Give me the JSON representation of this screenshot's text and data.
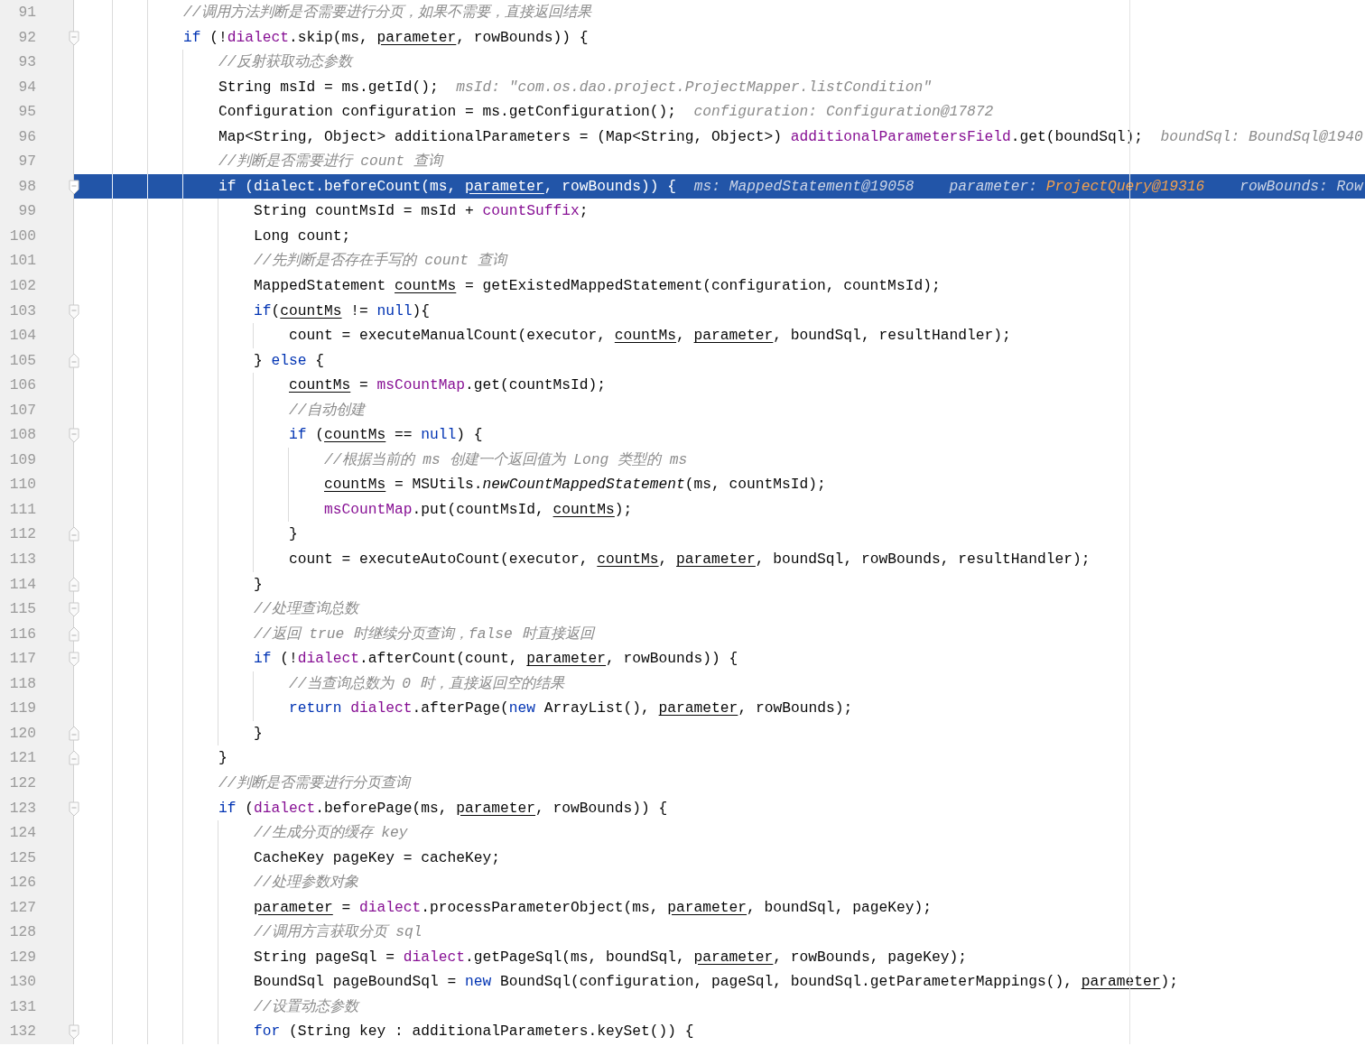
{
  "editor": {
    "lines": [
      {
        "number": "91",
        "selected": false,
        "tokens": [
          {
            "kind": "comment",
            "text": "            //调用方法判断是否需要进行分页，如果不需要，直接返回结果"
          }
        ]
      },
      {
        "number": "92",
        "selected": false,
        "fold": {
          "kind": "open"
        },
        "tokens": [
          {
            "kind": "keyword",
            "text": "            if"
          },
          {
            "kind": "plain",
            "text": " (!"
          },
          {
            "kind": "field",
            "text": "dialect"
          },
          {
            "kind": "plain",
            "text": ".skip(ms, "
          },
          {
            "kind": "var",
            "text": "parameter"
          },
          {
            "kind": "plain",
            "text": ", rowBounds)) {"
          }
        ]
      },
      {
        "number": "93",
        "selected": false,
        "tokens": [
          {
            "kind": "comment",
            "text": "                //反射获取动态参数"
          }
        ]
      },
      {
        "number": "94",
        "selected": false,
        "tokens": [
          {
            "kind": "plain",
            "text": "                String msId = ms.getId();"
          }
        ],
        "hints": [
          {
            "label": "msId:",
            "value": "\"com.os.dao.project.ProjectMapper.listCondition\"",
            "changed": false
          }
        ]
      },
      {
        "number": "95",
        "selected": false,
        "tokens": [
          {
            "kind": "plain",
            "text": "                Configuration configuration = ms.getConfiguration();"
          }
        ],
        "hints": [
          {
            "label": "configuration:",
            "value": "Configuration@17872",
            "changed": false
          }
        ]
      },
      {
        "number": "96",
        "selected": false,
        "tokens": [
          {
            "kind": "plain",
            "text": "                Map<String, Object> additionalParameters = (Map<String, Object>) "
          },
          {
            "kind": "field",
            "text": "additionalParametersField"
          },
          {
            "kind": "plain",
            "text": ".get(boundSql);"
          }
        ],
        "hints": [
          {
            "label": "boundSql:",
            "value": "BoundSql@1940",
            "changed": false
          }
        ]
      },
      {
        "number": "97",
        "selected": false,
        "tokens": [
          {
            "kind": "comment",
            "text": "                //判断是否需要进行 count 查询"
          }
        ]
      },
      {
        "number": "98",
        "selected": true,
        "fold": {
          "kind": "open"
        },
        "tokens": [
          {
            "kind": "keyword",
            "text": "                if"
          },
          {
            "kind": "plain",
            "text": " ("
          },
          {
            "kind": "field",
            "text": "dialect"
          },
          {
            "kind": "plain",
            "text": ".beforeCount(ms, "
          },
          {
            "kind": "var",
            "text": "parameter"
          },
          {
            "kind": "plain",
            "text": ", rowBounds)) {"
          }
        ],
        "hints": [
          {
            "label": "ms:",
            "value": "MappedStatement@19058",
            "changed": false
          },
          {
            "label": "parameter:",
            "value": "ProjectQuery@19316",
            "changed": true
          },
          {
            "label": "rowBounds:",
            "value": "Row",
            "changed": false
          }
        ]
      },
      {
        "number": "99",
        "selected": false,
        "tokens": [
          {
            "kind": "plain",
            "text": "                    String countMsId = msId + "
          },
          {
            "kind": "field",
            "text": "countSuffix"
          },
          {
            "kind": "plain",
            "text": ";"
          }
        ]
      },
      {
        "number": "100",
        "selected": false,
        "tokens": [
          {
            "kind": "plain",
            "text": "                    Long count;"
          }
        ]
      },
      {
        "number": "101",
        "selected": false,
        "tokens": [
          {
            "kind": "comment",
            "text": "                    //先判断是否存在手写的 count 查询"
          }
        ]
      },
      {
        "number": "102",
        "selected": false,
        "tokens": [
          {
            "kind": "plain",
            "text": "                    MappedStatement "
          },
          {
            "kind": "var",
            "text": "countMs"
          },
          {
            "kind": "plain",
            "text": " = getExistedMappedStatement(configuration, countMsId);"
          }
        ]
      },
      {
        "number": "103",
        "selected": false,
        "fold": {
          "kind": "open"
        },
        "tokens": [
          {
            "kind": "keyword",
            "text": "                    if"
          },
          {
            "kind": "plain",
            "text": "("
          },
          {
            "kind": "var",
            "text": "countMs"
          },
          {
            "kind": "plain",
            "text": " != "
          },
          {
            "kind": "keyword",
            "text": "null"
          },
          {
            "kind": "plain",
            "text": "){"
          }
        ]
      },
      {
        "number": "104",
        "selected": false,
        "tokens": [
          {
            "kind": "plain",
            "text": "                        count = executeManualCount(executor, "
          },
          {
            "kind": "var",
            "text": "countMs"
          },
          {
            "kind": "plain",
            "text": ", "
          },
          {
            "kind": "var",
            "text": "parameter"
          },
          {
            "kind": "plain",
            "text": ", boundSql, resultHandler);"
          }
        ]
      },
      {
        "number": "105",
        "selected": false,
        "fold": {
          "kind": "close"
        },
        "tokens": [
          {
            "kind": "plain",
            "text": "                    } "
          },
          {
            "kind": "keyword",
            "text": "else"
          },
          {
            "kind": "plain",
            "text": " {"
          }
        ]
      },
      {
        "number": "106",
        "selected": false,
        "tokens": [
          {
            "kind": "var",
            "text": "                        countMs"
          },
          {
            "kind": "plain",
            "text": " = "
          },
          {
            "kind": "field",
            "text": "msCountMap"
          },
          {
            "kind": "plain",
            "text": ".get(countMsId);"
          }
        ]
      },
      {
        "number": "107",
        "selected": false,
        "tokens": [
          {
            "kind": "comment",
            "text": "                        //自动创建"
          }
        ]
      },
      {
        "number": "108",
        "selected": false,
        "fold": {
          "kind": "open"
        },
        "tokens": [
          {
            "kind": "keyword",
            "text": "                        if"
          },
          {
            "kind": "plain",
            "text": " ("
          },
          {
            "kind": "var",
            "text": "countMs"
          },
          {
            "kind": "plain",
            "text": " == "
          },
          {
            "kind": "keyword",
            "text": "null"
          },
          {
            "kind": "plain",
            "text": ") {"
          }
        ]
      },
      {
        "number": "109",
        "selected": false,
        "tokens": [
          {
            "kind": "comment",
            "text": "                            //根据当前的 ms 创建一个返回值为 Long 类型的 ms"
          }
        ]
      },
      {
        "number": "110",
        "selected": false,
        "tokens": [
          {
            "kind": "var",
            "text": "                            countMs"
          },
          {
            "kind": "plain",
            "text": " = MSUtils."
          },
          {
            "kind": "static",
            "text": "newCountMappedStatement"
          },
          {
            "kind": "plain",
            "text": "(ms, countMsId);"
          }
        ]
      },
      {
        "number": "111",
        "selected": false,
        "tokens": [
          {
            "kind": "field",
            "text": "                            msCountMap"
          },
          {
            "kind": "plain",
            "text": ".put(countMsId, "
          },
          {
            "kind": "var",
            "text": "countMs"
          },
          {
            "kind": "plain",
            "text": ");"
          }
        ]
      },
      {
        "number": "112",
        "selected": false,
        "fold": {
          "kind": "close"
        },
        "tokens": [
          {
            "kind": "plain",
            "text": "                        }"
          }
        ]
      },
      {
        "number": "113",
        "selected": false,
        "tokens": [
          {
            "kind": "plain",
            "text": "                        count = executeAutoCount(executor, "
          },
          {
            "kind": "var",
            "text": "countMs"
          },
          {
            "kind": "plain",
            "text": ", "
          },
          {
            "kind": "var",
            "text": "parameter"
          },
          {
            "kind": "plain",
            "text": ", boundSql, rowBounds, resultHandler);"
          }
        ]
      },
      {
        "number": "114",
        "selected": false,
        "fold": {
          "kind": "close"
        },
        "tokens": [
          {
            "kind": "plain",
            "text": "                    }"
          }
        ]
      },
      {
        "number": "115",
        "selected": false,
        "fold": {
          "kind": "open"
        },
        "tokens": [
          {
            "kind": "comment",
            "text": "                    //处理查询总数"
          }
        ]
      },
      {
        "number": "116",
        "selected": false,
        "fold": {
          "kind": "close"
        },
        "tokens": [
          {
            "kind": "comment",
            "text": "                    //返回 true 时继续分页查询，false 时直接返回"
          }
        ]
      },
      {
        "number": "117",
        "selected": false,
        "fold": {
          "kind": "open"
        },
        "tokens": [
          {
            "kind": "keyword",
            "text": "                    if"
          },
          {
            "kind": "plain",
            "text": " (!"
          },
          {
            "kind": "field",
            "text": "dialect"
          },
          {
            "kind": "plain",
            "text": ".afterCount(count, "
          },
          {
            "kind": "var",
            "text": "parameter"
          },
          {
            "kind": "plain",
            "text": ", rowBounds)) {"
          }
        ]
      },
      {
        "number": "118",
        "selected": false,
        "tokens": [
          {
            "kind": "comment",
            "text": "                        //当查询总数为 0 时，直接返回空的结果"
          }
        ]
      },
      {
        "number": "119",
        "selected": false,
        "tokens": [
          {
            "kind": "keyword",
            "text": "                        return"
          },
          {
            "kind": "field",
            "text": " dialect"
          },
          {
            "kind": "plain",
            "text": ".afterPage("
          },
          {
            "kind": "keyword",
            "text": "new"
          },
          {
            "kind": "plain",
            "text": " ArrayList(), "
          },
          {
            "kind": "var",
            "text": "parameter"
          },
          {
            "kind": "plain",
            "text": ", rowBounds);"
          }
        ]
      },
      {
        "number": "120",
        "selected": false,
        "fold": {
          "kind": "close"
        },
        "tokens": [
          {
            "kind": "plain",
            "text": "                    }"
          }
        ]
      },
      {
        "number": "121",
        "selected": false,
        "fold": {
          "kind": "close"
        },
        "tokens": [
          {
            "kind": "plain",
            "text": "                }"
          }
        ]
      },
      {
        "number": "122",
        "selected": false,
        "tokens": [
          {
            "kind": "comment",
            "text": "                //判断是否需要进行分页查询"
          }
        ]
      },
      {
        "number": "123",
        "selected": false,
        "fold": {
          "kind": "open"
        },
        "tokens": [
          {
            "kind": "keyword",
            "text": "                if"
          },
          {
            "kind": "plain",
            "text": " ("
          },
          {
            "kind": "field",
            "text": "dialect"
          },
          {
            "kind": "plain",
            "text": ".beforePage(ms, "
          },
          {
            "kind": "var",
            "text": "parameter"
          },
          {
            "kind": "plain",
            "text": ", rowBounds)) {"
          }
        ]
      },
      {
        "number": "124",
        "selected": false,
        "tokens": [
          {
            "kind": "comment",
            "text": "                    //生成分页的缓存 key"
          }
        ]
      },
      {
        "number": "125",
        "selected": false,
        "tokens": [
          {
            "kind": "plain",
            "text": "                    CacheKey pageKey = cacheKey;"
          }
        ]
      },
      {
        "number": "126",
        "selected": false,
        "tokens": [
          {
            "kind": "comment",
            "text": "                    //处理参数对象"
          }
        ]
      },
      {
        "number": "127",
        "selected": false,
        "tokens": [
          {
            "kind": "var",
            "text": "                    parameter"
          },
          {
            "kind": "plain",
            "text": " = "
          },
          {
            "kind": "field",
            "text": "dialect"
          },
          {
            "kind": "plain",
            "text": ".processParameterObject(ms, "
          },
          {
            "kind": "var",
            "text": "parameter"
          },
          {
            "kind": "plain",
            "text": ", boundSql, pageKey);"
          }
        ]
      },
      {
        "number": "128",
        "selected": false,
        "tokens": [
          {
            "kind": "comment",
            "text": "                    //调用方言获取分页 sql"
          }
        ]
      },
      {
        "number": "129",
        "selected": false,
        "tokens": [
          {
            "kind": "plain",
            "text": "                    String pageSql = "
          },
          {
            "kind": "field",
            "text": "dialect"
          },
          {
            "kind": "plain",
            "text": ".getPageSql(ms, boundSql, "
          },
          {
            "kind": "var",
            "text": "parameter"
          },
          {
            "kind": "plain",
            "text": ", rowBounds, pageKey);"
          }
        ]
      },
      {
        "number": "130",
        "selected": false,
        "tokens": [
          {
            "kind": "plain",
            "text": "                    BoundSql pageBoundSql = "
          },
          {
            "kind": "keyword",
            "text": "new"
          },
          {
            "kind": "plain",
            "text": " BoundSql(configuration, pageSql, boundSql.getParameterMappings(), "
          },
          {
            "kind": "var",
            "text": "parameter"
          },
          {
            "kind": "plain",
            "text": ");"
          }
        ]
      },
      {
        "number": "131",
        "selected": false,
        "tokens": [
          {
            "kind": "comment",
            "text": "                    //设置动态参数"
          }
        ]
      },
      {
        "number": "132",
        "selected": false,
        "fold": {
          "kind": "open"
        },
        "tokens": [
          {
            "kind": "keyword",
            "text": "                    for"
          },
          {
            "kind": "plain",
            "text": " (String key : additionalParameters.keySet()) {"
          }
        ]
      }
    ]
  }
}
